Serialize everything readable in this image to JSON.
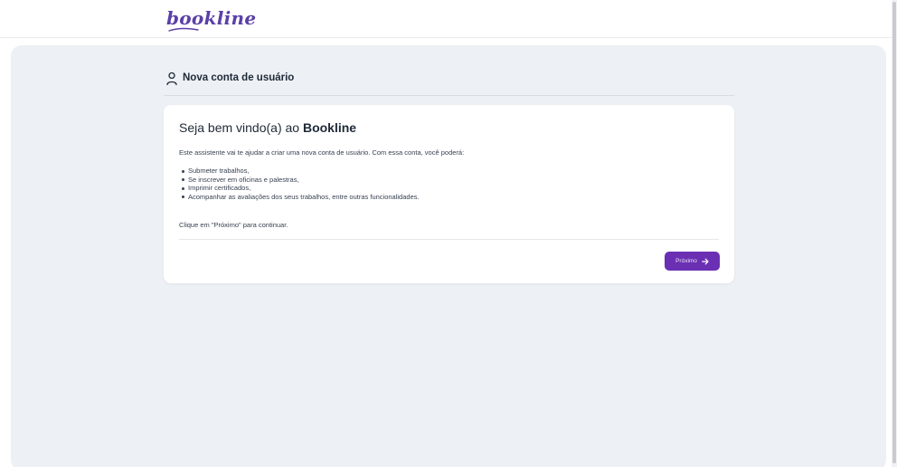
{
  "header": {
    "logo_text": "bookline"
  },
  "section": {
    "title": "Nova conta de usuário"
  },
  "card": {
    "welcome_prefix": "Seja bem vindo(a) ao ",
    "welcome_brand": "Bookline",
    "intro": "Este assistente vai te ajudar a criar uma nova conta de usuário. Com essa conta, você poderá:",
    "features": [
      "Submeter trabalhos,",
      "Se inscrever em oficinas e palestras,",
      "Imprimir certificados,",
      "Acompanhar as avaliações dos seus trabalhos, entre outras funcionalidades."
    ],
    "cta": "Clique em \"Próximo\" para continuar.",
    "next_label": "Próximo"
  },
  "icons": {
    "section": "user-icon",
    "next": "arrow-right-icon"
  },
  "colors": {
    "brand": "#5b3fa8",
    "button": "#6b2fb3",
    "panel_background": "#edf1f5"
  }
}
